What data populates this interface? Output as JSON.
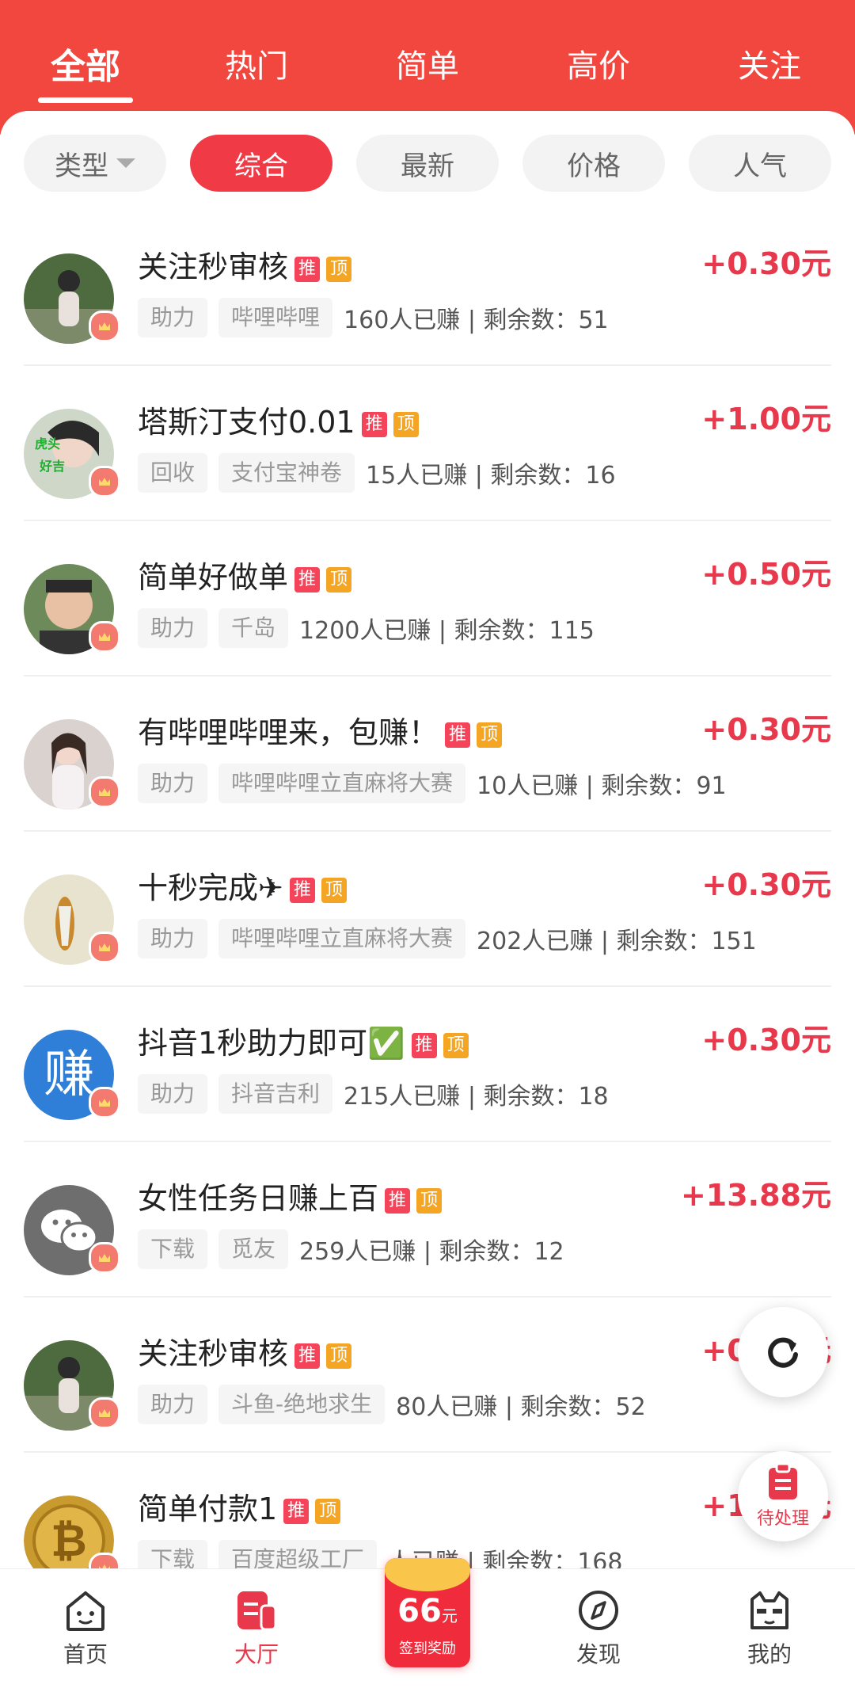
{
  "top_tabs": [
    {
      "label": "全部",
      "active": true
    },
    {
      "label": "热门",
      "active": false
    },
    {
      "label": "简单",
      "active": false
    },
    {
      "label": "高价",
      "active": false
    },
    {
      "label": "关注",
      "active": false
    }
  ],
  "filters": [
    {
      "label": "类型",
      "active": false,
      "dropdown": true
    },
    {
      "label": "综合",
      "active": true
    },
    {
      "label": "最新",
      "active": false
    },
    {
      "label": "价格",
      "active": false
    },
    {
      "label": "人气",
      "active": false
    }
  ],
  "badges": {
    "tui": "推",
    "ding": "顶"
  },
  "tasks": [
    {
      "title": "关注秒审核",
      "price": "+0.30元",
      "tags": [
        "助力",
        "哔哩哔哩"
      ],
      "stats": "160人已赚 | 剩余数：51",
      "avatar": "photo"
    },
    {
      "title": "塔斯汀支付0.01",
      "price": "+1.00元",
      "tags": [
        "回收",
        "支付宝神卷"
      ],
      "stats": "15人已赚 | 剩余数：16",
      "avatar": "photo"
    },
    {
      "title": "简单好做单",
      "price": "+0.50元",
      "tags": [
        "助力",
        "千岛"
      ],
      "stats": "1200人已赚 | 剩余数：115",
      "avatar": "photo"
    },
    {
      "title": "有哔哩哔哩来，包赚！",
      "price": "+0.30元",
      "tags": [
        "助力",
        "哔哩哔哩立直麻将大赛"
      ],
      "stats": "10人已赚 | 剩余数：91",
      "avatar": "photo"
    },
    {
      "title": "十秒完成✈",
      "price": "+0.30元",
      "tags": [
        "助力",
        "哔哩哔哩立直麻将大赛"
      ],
      "stats": "202人已赚 | 剩余数：151",
      "avatar": "photo"
    },
    {
      "title": "抖音1秒助力即可✅",
      "price": "+0.30元",
      "tags": [
        "助力",
        "抖音吉利"
      ],
      "stats": "215人已赚 | 剩余数：18",
      "avatar": "earn",
      "avatar_text": "赚"
    },
    {
      "title": "女性任务日赚上百",
      "price": "+13.88元",
      "tags": [
        "下载",
        "觅友"
      ],
      "stats": "259人已赚 | 剩余数：12",
      "avatar": "wechat"
    },
    {
      "title": "关注秒审核",
      "price": "+0.30元",
      "tags": [
        "助力",
        "斗鱼-绝地求生"
      ],
      "stats": "80人已赚 | 剩余数：52",
      "avatar": "photo"
    },
    {
      "title": "简单付款1",
      "price": "+1.00元",
      "tags": [
        "下载",
        "百度超级工厂"
      ],
      "stats": "人已赚 | 剩余数：168",
      "avatar": "bitcoin"
    }
  ],
  "fab": {
    "pending_label": "待处理"
  },
  "bottom_nav": {
    "home": "首页",
    "hall": "大厅",
    "discover": "发现",
    "mine": "我的",
    "signin_amount": "66",
    "signin_unit": "元",
    "signin_label": "签到奖励"
  },
  "colors": {
    "brand": "#f2473f",
    "accent": "#e8394c"
  }
}
